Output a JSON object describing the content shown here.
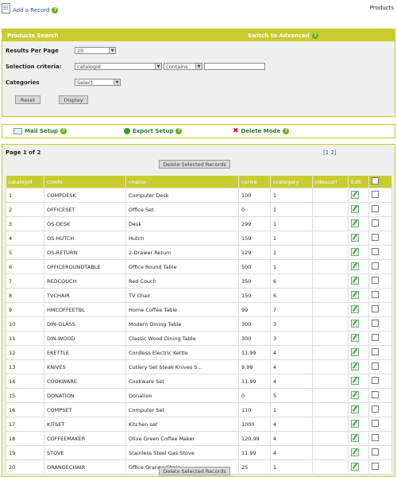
{
  "top": {
    "add_record": "Add a Record",
    "products": "Products"
  },
  "search": {
    "title": "Products  Search",
    "switch_advanced": "Switch to Advanced",
    "results_per_page_label": "Results Per Page",
    "results_per_page_value": "20",
    "criteria_label": "Selection criteria:",
    "criteria_field": "catalogid",
    "criteria_op": "contains",
    "criteria_value": "",
    "categories_label": "Categories",
    "categories_value": "Select",
    "reset": "Reset",
    "display": "Display"
  },
  "tools": {
    "mail": "Mail Setup",
    "export": "Export Setup",
    "delete_mode": "Delete Mode"
  },
  "results": {
    "page_info": "Page 1 of 2",
    "pager_open": "[",
    "pager_pages": [
      "1",
      "2"
    ],
    "pager_close": "]",
    "delete_selected": "Delete Selected Records",
    "columns": [
      "catalogid",
      "ccode",
      "cname",
      "cprice",
      "ccategory",
      "cdescurl",
      "Edit"
    ],
    "rows": [
      [
        "1",
        "COMPDESK",
        "Computer Desk",
        "100",
        "1",
        ""
      ],
      [
        "2",
        "OFFICESET",
        "Office Set",
        "0",
        "1",
        ""
      ],
      [
        "3",
        "OS-DESK",
        "Desk",
        "299",
        "1",
        ""
      ],
      [
        "4",
        "OS-HUTCH",
        "Hutch",
        "159",
        "1",
        ""
      ],
      [
        "5",
        "OS-RETURN",
        "2-Drawer Return",
        "129",
        "1",
        ""
      ],
      [
        "6",
        "OFFICEROUNDTABLE",
        "Office Round Table",
        "500",
        "1",
        ""
      ],
      [
        "7",
        "REDCOUCH",
        "Red Couch",
        "350",
        "6",
        ""
      ],
      [
        "8",
        "TVCHAIR",
        "TV Chair",
        "150",
        "6",
        ""
      ],
      [
        "9",
        "HMCOFFEETBL",
        "Home Coffee Table",
        "99",
        "7",
        ""
      ],
      [
        "10",
        "DIN-GLASS",
        "Modern Dining Table",
        "300",
        "3",
        ""
      ],
      [
        "11",
        "DIN-WOOD",
        "Classic Wood Dining Table",
        "300",
        "3",
        ""
      ],
      [
        "12",
        "EKETTLE",
        "Cordless Electric Kettle",
        "11.99",
        "4",
        ""
      ],
      [
        "13",
        "KNIVES",
        "Cutlery Set Steak Knives S...",
        "9.99",
        "4",
        ""
      ],
      [
        "14",
        "COOKWARE",
        "Cookware Set",
        "11.99",
        "4",
        ""
      ],
      [
        "15",
        "DONATION",
        "Donation",
        "0",
        "5",
        ""
      ],
      [
        "16",
        "COMPSET",
        "Computer Set",
        "110",
        "1",
        ""
      ],
      [
        "17",
        "KITSET",
        "Kitchen set",
        "1000",
        "4",
        ""
      ],
      [
        "18",
        "COFFEEMAKER",
        "Olive Green Coffee Maker",
        "120.99",
        "4",
        ""
      ],
      [
        "19",
        "STOVE",
        "Stainless Steel Gas Stove",
        "11.99",
        "4",
        ""
      ],
      [
        "20",
        "ORANGECHAIR",
        "Office Orange Chair",
        "25",
        "1",
        ""
      ]
    ]
  }
}
